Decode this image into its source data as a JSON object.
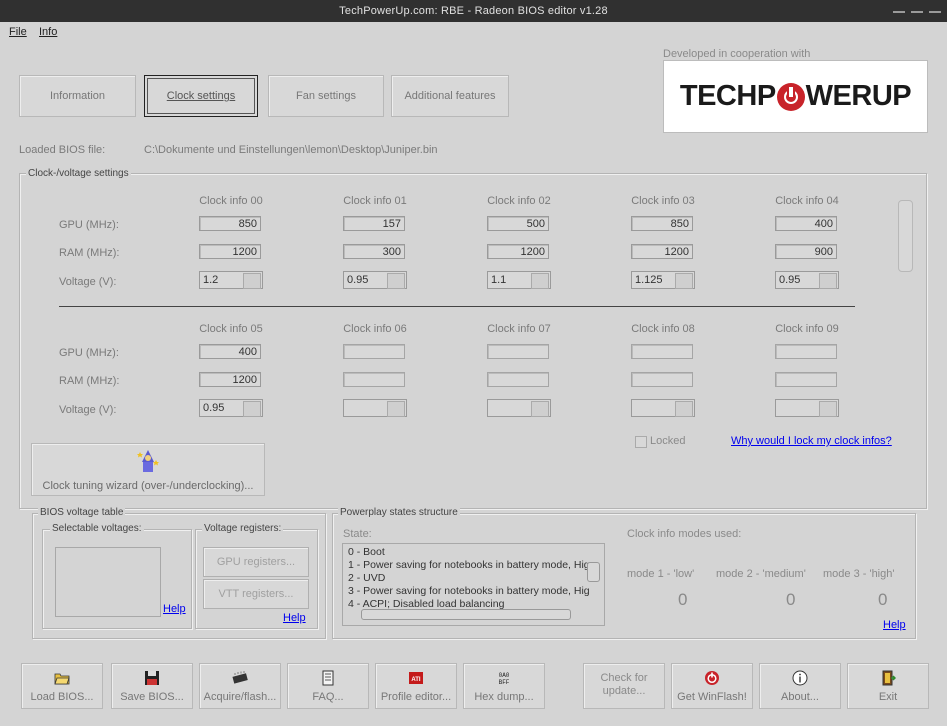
{
  "window": {
    "title": "TechPowerUp.com: RBE - Radeon BIOS editor v1.28"
  },
  "menu": {
    "file": "File",
    "info": "Info"
  },
  "tabs": [
    {
      "label": "Information"
    },
    {
      "label": "Clock settings",
      "active": true
    },
    {
      "label": "Fan settings"
    },
    {
      "label": "Additional features"
    }
  ],
  "logo": {
    "caption": "Developed in cooperation with",
    "text_left": "TECHP",
    "text_right": "WERUP"
  },
  "bios": {
    "label": "Loaded BIOS file:",
    "path": "C:\\Dokumente und Einstellungen\\lemon\\Desktop\\Juniper.bin"
  },
  "clock_group": {
    "title": "Clock-/voltage settings",
    "row_labels": {
      "gpu": "GPU (MHz):",
      "ram": "RAM (MHz):",
      "voltage": "Voltage (V):"
    },
    "clock_infos": [
      {
        "name": "Clock info 00",
        "gpu": "850",
        "ram": "1200",
        "voltage": "1.2"
      },
      {
        "name": "Clock info 01",
        "gpu": "157",
        "ram": "300",
        "voltage": "0.95"
      },
      {
        "name": "Clock info 02",
        "gpu": "500",
        "ram": "1200",
        "voltage": "1.1"
      },
      {
        "name": "Clock info 03",
        "gpu": "850",
        "ram": "1200",
        "voltage": "1.125"
      },
      {
        "name": "Clock info 04",
        "gpu": "400",
        "ram": "900",
        "voltage": "0.95"
      },
      {
        "name": "Clock info 05",
        "gpu": "400",
        "ram": "1200",
        "voltage": "0.95"
      },
      {
        "name": "Clock info 06",
        "gpu": "",
        "ram": "",
        "voltage": ""
      },
      {
        "name": "Clock info 07",
        "gpu": "",
        "ram": "",
        "voltage": ""
      },
      {
        "name": "Clock info 08",
        "gpu": "",
        "ram": "",
        "voltage": ""
      },
      {
        "name": "Clock info 09",
        "gpu": "",
        "ram": "",
        "voltage": ""
      }
    ],
    "locked_label": "Locked",
    "lock_link": "Why would I lock my clock infos?",
    "wizard_label": "Clock tuning wizard (over-/underclocking)..."
  },
  "voltage_table": {
    "title": "BIOS voltage table",
    "selectable_title": "Selectable voltages:",
    "registers_title": "Voltage registers:",
    "gpu_registers": "GPU registers...",
    "vtt_registers": "VTT registers...",
    "help": "Help"
  },
  "powerplay": {
    "title": "Powerplay states structure",
    "state_label": "State:",
    "states": [
      "0 - Boot",
      "1 - Power saving for notebooks in battery mode, Hig",
      "2 - UVD",
      "3 - Power saving for notebooks in battery mode, Hig",
      "4 - ACPI; Disabled load balancing"
    ],
    "modes_title": "Clock info modes used:",
    "modes": [
      {
        "label": "mode 1 - 'low'",
        "value": "0"
      },
      {
        "label": "mode 2 - 'medium'",
        "value": "0"
      },
      {
        "label": "mode 3 - 'high'",
        "value": "0"
      }
    ],
    "help": "Help"
  },
  "toolbar": [
    {
      "label": "Load BIOS...",
      "icon": "folder-icon"
    },
    {
      "label": "Save BIOS...",
      "icon": "floppy-icon"
    },
    {
      "label": "Acquire/flash...",
      "icon": "chip-icon"
    },
    {
      "label": "FAQ...",
      "icon": "document-icon"
    },
    {
      "label": "Profile editor...",
      "icon": "ati-icon"
    },
    {
      "label": "Hex dump...",
      "icon": "hex-icon"
    },
    {
      "label": "Check for update...",
      "icon": ""
    },
    {
      "label": "Get WinFlash!",
      "icon": "power-icon"
    },
    {
      "label": "About...",
      "icon": "info-icon"
    },
    {
      "label": "Exit",
      "icon": "exit-icon"
    }
  ]
}
